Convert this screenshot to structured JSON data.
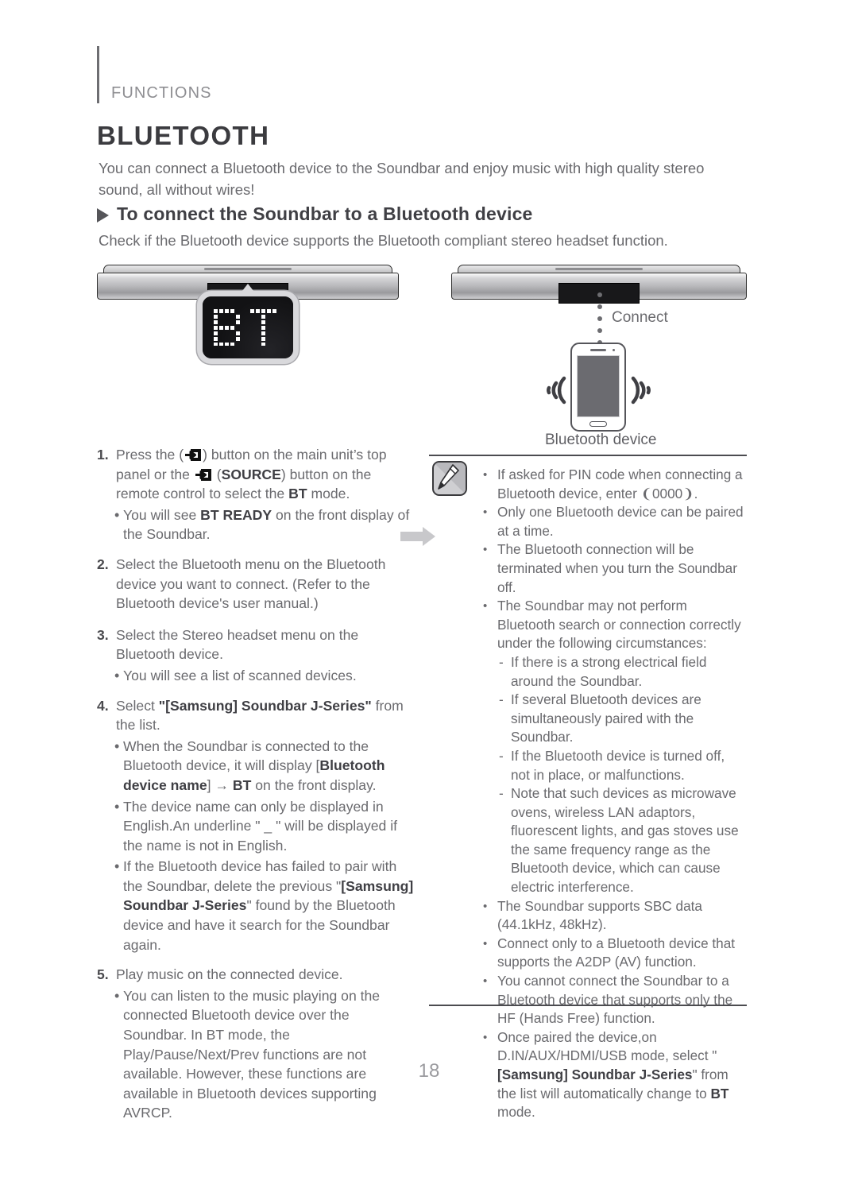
{
  "header": {
    "kicker": "FUNCTIONS",
    "title": "BLUETOOTH",
    "intro": "You can connect a Bluetooth device to the Soundbar and enjoy music with high quality stereo sound, all without wires!",
    "subtitle": "To connect the Soundbar to a Bluetooth device",
    "check_line": "Check if the Bluetooth device supports the Bluetooth compliant stereo headset function."
  },
  "figure": {
    "display_text": "BT",
    "connect_label": "Connect",
    "device_label": "Bluetooth device"
  },
  "steps": [
    {
      "num": "1.",
      "parts": [
        {
          "t": "Press the ("
        },
        {
          "icon": "source-icon"
        },
        {
          "t": ") button on the main unit’s top panel or the "
        },
        {
          "icon": "source-icon"
        },
        {
          "t": " ("
        },
        {
          "b": "SOURCE"
        },
        {
          "t": ") button on the remote control to select the "
        },
        {
          "b": "BT"
        },
        {
          "t": " mode."
        }
      ],
      "subs": [
        {
          "parts": [
            {
              "t": "You will see "
            },
            {
              "b": "BT READY"
            },
            {
              "t": " on the front display of the Soundbar."
            }
          ]
        }
      ]
    },
    {
      "num": "2.",
      "parts": [
        {
          "t": "Select the Bluetooth menu on the Bluetooth device you want to connect. (Refer to the Bluetooth device's user manual.)"
        }
      ],
      "subs": []
    },
    {
      "num": "3.",
      "parts": [
        {
          "t": "Select the Stereo headset menu on the Bluetooth device."
        }
      ],
      "subs": [
        {
          "parts": [
            {
              "t": "You will see a list of scanned devices."
            }
          ]
        }
      ]
    },
    {
      "num": "4.",
      "parts": [
        {
          "t": "Select "
        },
        {
          "b": "\"[Samsung] Soundbar J-Series\""
        },
        {
          "t": " from the list."
        }
      ],
      "subs": [
        {
          "parts": [
            {
              "t": "When the Soundbar is connected to the Bluetooth device, it will display ["
            },
            {
              "b": "Bluetooth device name"
            },
            {
              "t": "] → "
            },
            {
              "b": "BT"
            },
            {
              "t": " on the front display."
            }
          ]
        },
        {
          "parts": [
            {
              "t": "The device name can only be displayed in English.An underline \" _ \" will be displayed if the name is not in English."
            }
          ]
        },
        {
          "parts": [
            {
              "t": "If the Bluetooth device has failed to pair with the Soundbar, delete the previous \""
            },
            {
              "b": "[Samsung] Soundbar J-Series"
            },
            {
              "t": "\" found by the Bluetooth device and have it search for the Soundbar again."
            }
          ]
        }
      ]
    },
    {
      "num": "5.",
      "parts": [
        {
          "t": "Play music on the connected device."
        }
      ],
      "subs": [
        {
          "parts": [
            {
              "t": "You can listen to the music playing on the connected Bluetooth device over the Soundbar. In BT mode, the Play/Pause/Next/Prev functions are not available. However, these functions are available in Bluetooth devices supporting AVRCP."
            }
          ]
        }
      ]
    }
  ],
  "notes": [
    {
      "parts": [
        {
          "t": "If asked for PIN code when connecting a Bluetooth device, enter ❨0000❩."
        }
      ]
    },
    {
      "parts": [
        {
          "t": "Only one Bluetooth device can be paired at a time."
        }
      ]
    },
    {
      "parts": [
        {
          "t": "The Bluetooth connection will be terminated when you turn the Soundbar off."
        }
      ]
    },
    {
      "parts": [
        {
          "t": "The Soundbar may not perform Bluetooth search or connection correctly under the following circumstances:"
        }
      ],
      "dashes": [
        "If there is a strong electrical field around the Soundbar.",
        "If several Bluetooth devices are simultaneously paired with the Soundbar.",
        "If the Bluetooth device is turned off, not in place, or malfunctions.",
        "Note that such devices as microwave ovens, wireless LAN adaptors, fluorescent lights, and gas stoves use the same frequency range as the Bluetooth device, which can cause electric interference."
      ]
    },
    {
      "parts": [
        {
          "t": "The Soundbar supports SBC data (44.1kHz, 48kHz)."
        }
      ]
    },
    {
      "parts": [
        {
          "t": "Connect only to a Bluetooth device that supports the A2DP (AV) function."
        }
      ]
    },
    {
      "parts": [
        {
          "t": "You cannot connect the Soundbar to a Bluetooth device that supports only the HF (Hands Free) function."
        }
      ]
    },
    {
      "parts": [
        {
          "t": "Once paired the device,on D.IN/AUX/HDMI/USB mode, select \""
        },
        {
          "b": "[Samsung] Soundbar J-Series"
        },
        {
          "t": "\" from the list will automatically change to "
        },
        {
          "b": "BT"
        },
        {
          "t": " mode."
        }
      ]
    }
  ],
  "footer": {
    "page_number": "18"
  },
  "colors": {
    "text": "#6a6a6e",
    "heading": "#3b3b3f",
    "rule": "#4c4c50",
    "display_bg": "#18181a"
  }
}
